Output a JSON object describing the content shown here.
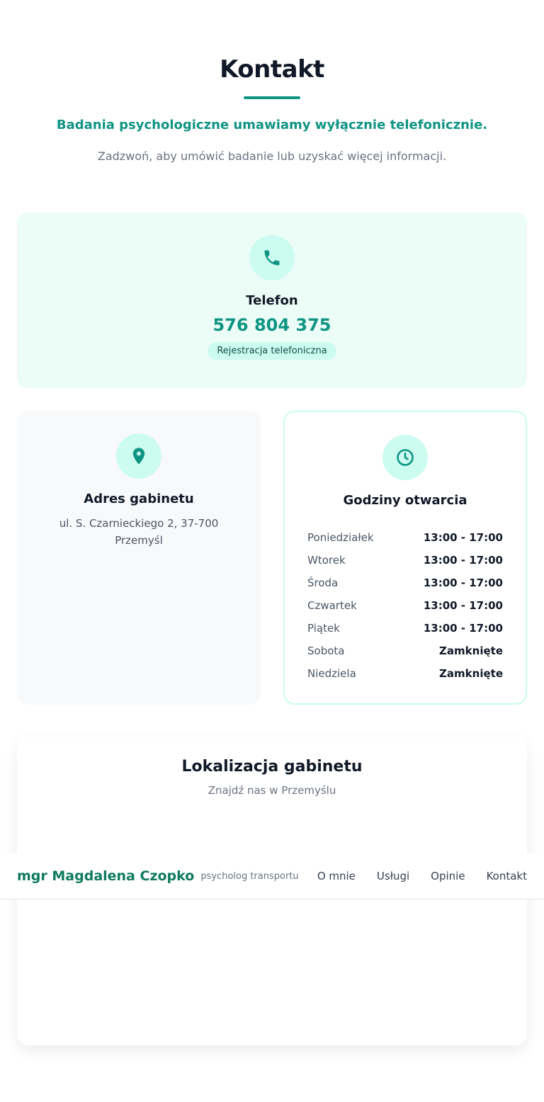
{
  "section": {
    "title": "Kontakt",
    "lead": "Badania psychologiczne umawiamy wyłącznie telefonicznie.",
    "sublead": "Zadzwoń, aby umówić badanie lub uzyskać więcej informacji."
  },
  "phone": {
    "icon": "phone-icon",
    "heading": "Telefon",
    "number": "576 804 375",
    "badge": "Rejestracja telefoniczna"
  },
  "address": {
    "icon": "map-pin-icon",
    "heading": "Adres gabinetu",
    "line": "ul. S. Czarnieckiego 2, 37-700 Przemyśl"
  },
  "hours": {
    "icon": "clock-icon",
    "heading": "Godziny otwarcia",
    "rows": [
      {
        "day": "Poniedziałek",
        "time": "13:00 - 17:00"
      },
      {
        "day": "Wtorek",
        "time": "13:00 - 17:00"
      },
      {
        "day": "Środa",
        "time": "13:00 - 17:00"
      },
      {
        "day": "Czwartek",
        "time": "13:00 - 17:00"
      },
      {
        "day": "Piątek",
        "time": "13:00 - 17:00"
      },
      {
        "day": "Sobota",
        "time": "Zamknięte"
      },
      {
        "day": "Niedziela",
        "time": "Zamknięte"
      }
    ]
  },
  "map": {
    "title": "Lokalizacja gabinetu",
    "subtitle": "Znajdź nas w Przemyślu"
  },
  "nav": {
    "brand": "mgr Magdalena Czopko",
    "tagline": "psycholog transportu",
    "links": [
      "O mnie",
      "Usługi",
      "Opinie",
      "Kontakt"
    ]
  },
  "colors": {
    "accent": "#0f9484",
    "brand": "#0f7a5f",
    "icon_bg": "#ccfbef",
    "phone_card_bg": "#ecfdf7"
  }
}
